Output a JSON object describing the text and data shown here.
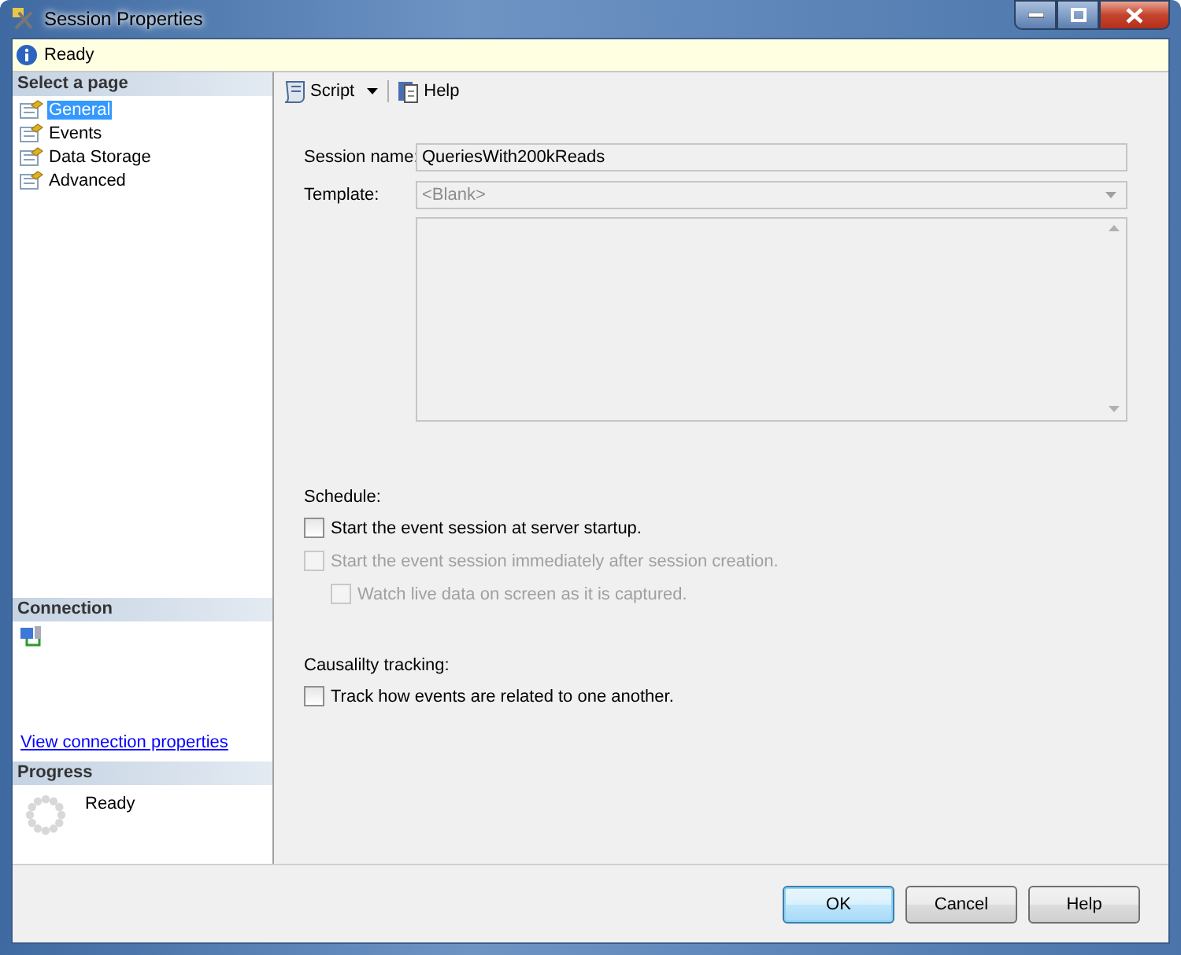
{
  "window": {
    "title": "Session Properties"
  },
  "status_bar": {
    "text": "Ready"
  },
  "sidebar": {
    "select_page": {
      "header": "Select a page",
      "items": [
        {
          "label": "General",
          "selected": true
        },
        {
          "label": "Events",
          "selected": false
        },
        {
          "label": "Data Storage",
          "selected": false
        },
        {
          "label": "Advanced",
          "selected": false
        }
      ]
    },
    "connection": {
      "header": "Connection",
      "link": "View connection properties"
    },
    "progress": {
      "header": "Progress",
      "status": "Ready"
    }
  },
  "toolbar": [
    {
      "label": "Script",
      "kind": "dropdown"
    },
    {
      "label": "Help",
      "kind": "button"
    }
  ],
  "form": {
    "session_name": {
      "label": "Session name:",
      "value": "QueriesWith200kReads"
    },
    "template": {
      "label": "Template:",
      "value": "<Blank>",
      "disabled": true
    },
    "schedule": {
      "header": "Schedule:",
      "options": [
        {
          "label": "Start the event session at server startup.",
          "checked": false,
          "disabled": false
        },
        {
          "label": "Start the event session immediately after session creation.",
          "checked": false,
          "disabled": true,
          "children": [
            {
              "label": "Watch live data on screen as it is captured.",
              "checked": false,
              "disabled": true
            }
          ]
        }
      ]
    },
    "causality": {
      "header": "Causalilty tracking:",
      "options": [
        {
          "label": "Track how events are related to one another.",
          "checked": false,
          "disabled": false
        }
      ]
    }
  },
  "buttons": [
    {
      "label": "OK",
      "default": true
    },
    {
      "label": "Cancel",
      "default": false
    },
    {
      "label": "Help",
      "default": false
    }
  ]
}
